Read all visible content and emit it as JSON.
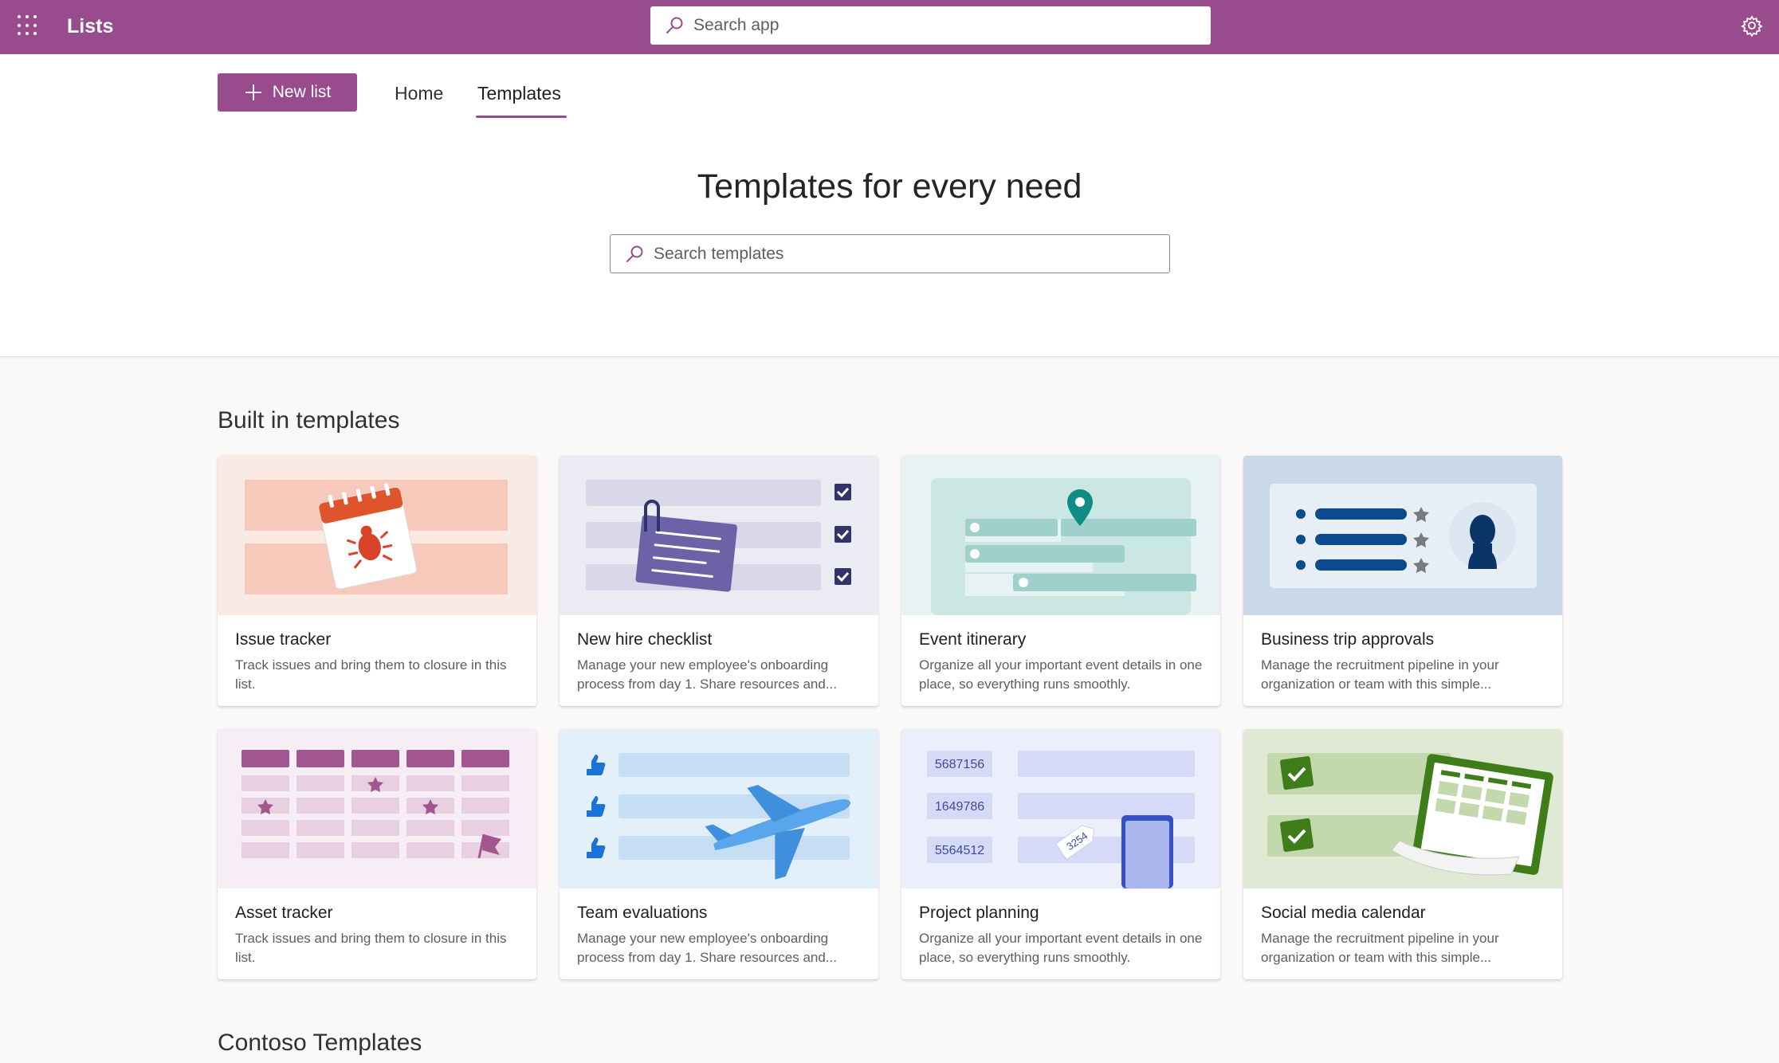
{
  "app": {
    "title": "Lists",
    "search_placeholder": "Search app"
  },
  "nav": {
    "new_list": "New list",
    "home": "Home",
    "templates": "Templates"
  },
  "hero": {
    "title": "Templates for every need",
    "search_placeholder": "Search templates"
  },
  "sections": {
    "built_in": "Built in templates",
    "contoso": "Contoso Templates"
  },
  "cards": [
    {
      "title": "Issue tracker",
      "desc": "Track issues and bring them to closure in this list.",
      "icon": "bug-calendar-illustration",
      "bg": "#fbe9e3"
    },
    {
      "title": "New hire checklist",
      "desc": "Manage your new employee's onboarding process from day 1. Share resources and...",
      "icon": "checklist-illustration",
      "bg": "#ebebf3"
    },
    {
      "title": "Event itinerary",
      "desc": "Organize all your important event details in one place, so everything runs smoothly.",
      "icon": "map-pin-illustration",
      "bg": "#e6f3f2"
    },
    {
      "title": "Business trip approvals",
      "desc": "Manage the recruitment pipeline in your organization or team with this simple...",
      "icon": "person-card-illustration",
      "bg": "#c9d9e8"
    },
    {
      "title": "Asset tracker",
      "desc": "Track issues and bring them to closure in this list.",
      "icon": "grid-star-illustration",
      "bg": "#f7eef5"
    },
    {
      "title": "Team evaluations",
      "desc": "Manage your new employee's onboarding process from day 1. Share resources and...",
      "icon": "airplane-illustration",
      "bg": "#e3f0fa"
    },
    {
      "title": "Project planning",
      "desc": "Organize all your important event details in one place, so everything runs smoothly.",
      "icon": "phone-tag-illustration",
      "bg": "#eceefb",
      "numbers": [
        "5687156",
        "1649786",
        "5564512"
      ],
      "tag": "3254"
    },
    {
      "title": "Social media calendar",
      "desc": "Manage the recruitment pipeline in your organization or team with this simple...",
      "icon": "calendar-check-illustration",
      "bg": "#dfe9d3"
    }
  ],
  "colors": {
    "brand": "#984c8e",
    "text": "#323130",
    "subtext": "#605e5c"
  }
}
